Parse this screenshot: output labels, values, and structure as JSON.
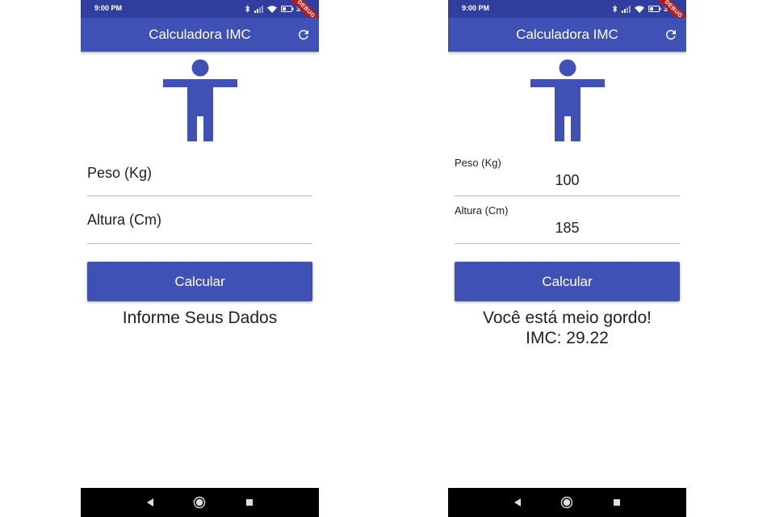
{
  "status_bar": {
    "time": "9:00 PM",
    "battery": "30",
    "debug_banner": "DEBUG"
  },
  "colors": {
    "primary": "#3f51b5",
    "primary_dark": "#303f9f",
    "debug_ribbon": "#b71c1c"
  },
  "icons": [
    "bluetooth-icon",
    "signal-icon",
    "wifi-icon",
    "battery-icon",
    "refresh-icon",
    "person-icon",
    "back-icon",
    "home-icon",
    "recents-icon"
  ],
  "screens": [
    {
      "appbar_title": "Calculadora IMC",
      "weight_field": {
        "placeholder": "Peso (Kg)",
        "value": ""
      },
      "height_field": {
        "placeholder": "Altura (Cm)",
        "value": ""
      },
      "button_label": "Calcular",
      "result_lines": [
        "Informe Seus Dados"
      ]
    },
    {
      "appbar_title": "Calculadora IMC",
      "weight_field": {
        "label": "Peso (Kg)",
        "value": "100"
      },
      "height_field": {
        "label": "Altura (Cm)",
        "value": "185"
      },
      "button_label": "Calcular",
      "result_lines": [
        "Você está meio gordo!",
        "IMC: 29.22"
      ]
    }
  ]
}
